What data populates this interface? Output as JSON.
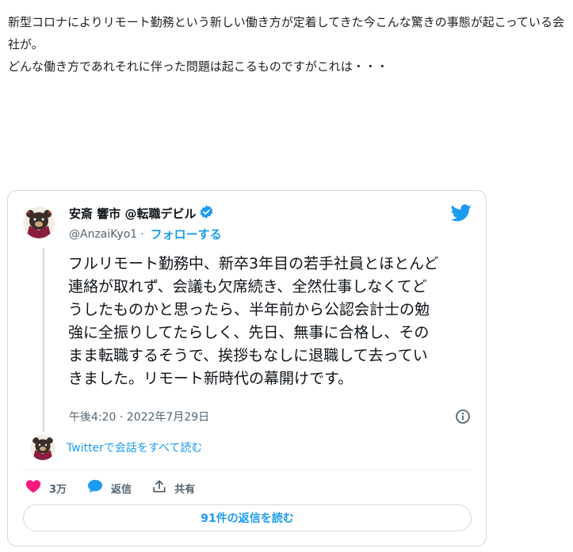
{
  "article": {
    "line1": "新型コロナによりリモート勤務という新しい働き方が定着してきた今こんな驚きの事態が起こっている会社が。",
    "line2": "どんな働き方であれそれに伴った問題は起こるものですがこれは・・・"
  },
  "tweet": {
    "display_name": "安斎 響市 @転職デビル",
    "handle": "@AnzaiKyo1",
    "separator": "·",
    "follow_label": "フォローする",
    "text": "フルリモート勤務中、新卒3年目の若手社員とほとんど連絡が取れず、会議も欠席続き、全然仕事しなくてどうしたものかと思ったら、半年前から公認会計士の勉強に全振りしてたらしく、先日、無事に合格し、そのまま転職するそうで、挨拶もなしに退職して去っていきました。リモート新時代の幕開けです。",
    "timestamp": "午後4:20 · 2022年7月29日",
    "read_conversation": "Twitterで会話をすべて読む",
    "like_count": "3万",
    "reply_label": "返信",
    "share_label": "共有",
    "read_replies": "91件の返信を読む"
  },
  "colors": {
    "twitter_blue": "#1d9bf0",
    "like_pink": "#f91880",
    "text_secondary": "#536471",
    "border": "#cfd9de"
  },
  "icons": {
    "verified": "verified-badge-icon",
    "brand": "twitter-bird-icon",
    "info": "info-icon",
    "like": "heart-icon",
    "reply": "speech-bubble-icon",
    "share": "share-upload-icon"
  }
}
